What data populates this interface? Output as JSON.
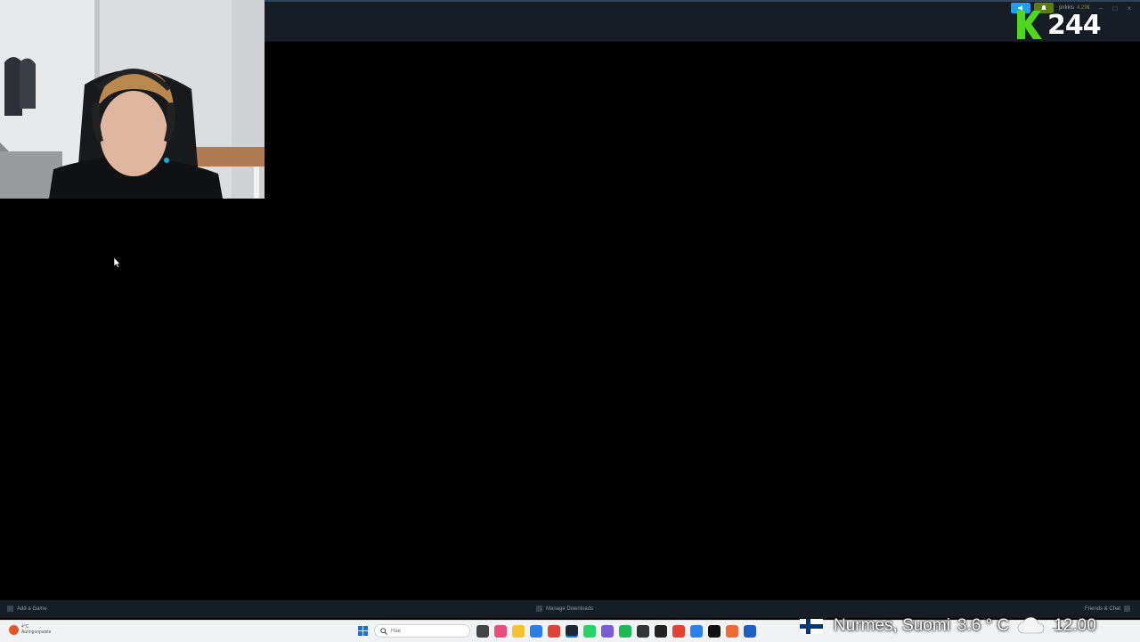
{
  "steam_header": {
    "user_name": "pirkkis",
    "wallet": "4,29€"
  },
  "stream_overlay": {
    "counter_letter": "K",
    "counter_value": "244",
    "location": "Nurmes, Suomi",
    "temperature": "3.6 ° C",
    "time": "12.00",
    "weather_icon": "cloud-icon"
  },
  "steam_footer": {
    "add_game": "Add a Game",
    "manage_downloads": "Manage Downloads",
    "friends_chat": "Friends & Chat"
  },
  "taskbar": {
    "weather_temp": "4°C",
    "weather_desc": "Auringonpaiste",
    "search_placeholder": "Hae"
  },
  "colors": {
    "steam_dark": "#171d25",
    "accent_blue": "#1a9fff",
    "accent_green": "#5c7e10",
    "counter_green": "#4fd61e"
  }
}
